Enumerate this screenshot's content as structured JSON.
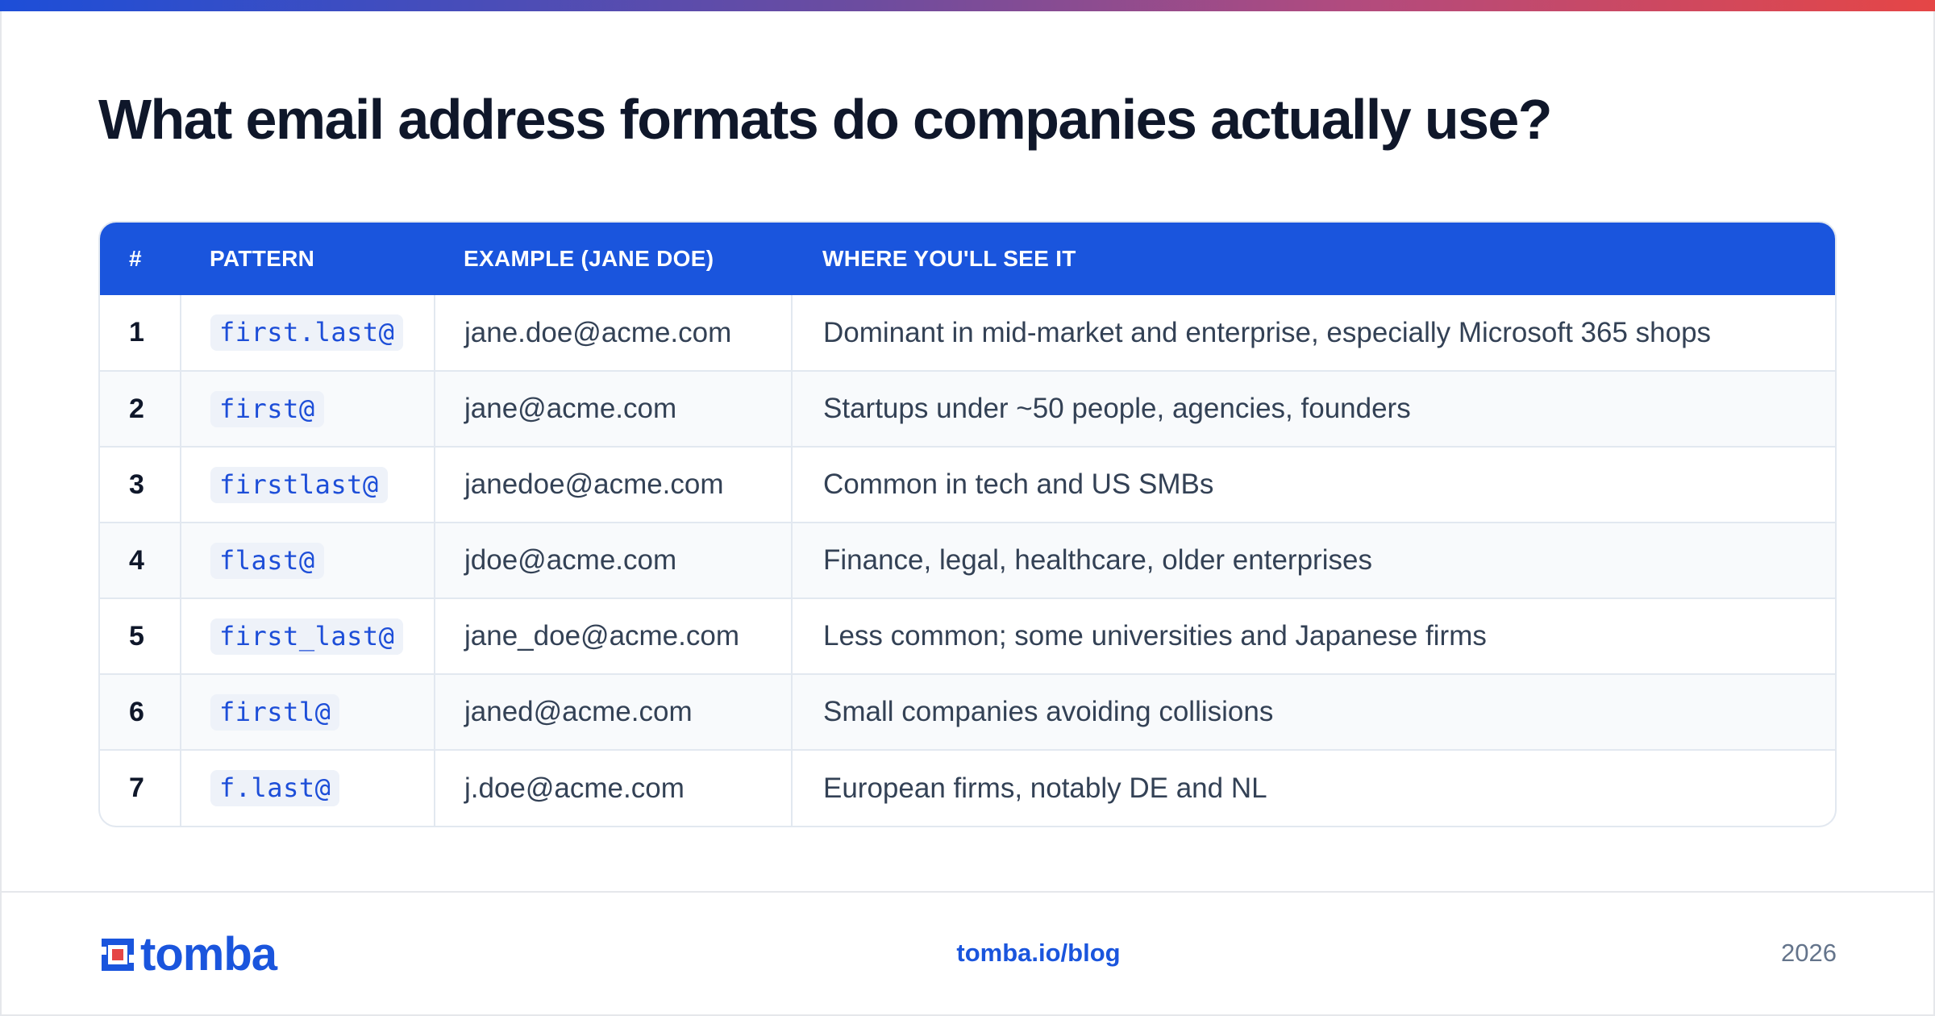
{
  "title": "What email address formats do companies actually use?",
  "colors": {
    "accent": "#1a55dd",
    "header_bg": "#1a55dd",
    "code_text": "#1d4ed8",
    "gradient_start": "#1d4ed8",
    "gradient_end": "#e54646"
  },
  "table": {
    "headers": {
      "num": "#",
      "pattern": "PATTERN",
      "example": "EXAMPLE (JANE DOE)",
      "where": "WHERE YOU'LL SEE IT"
    },
    "rows": [
      {
        "num": "1",
        "pattern": "first.last@",
        "example": "jane.doe@acme.com",
        "where": "Dominant in mid-market and enterprise, especially Microsoft 365 shops"
      },
      {
        "num": "2",
        "pattern": "first@",
        "example": "jane@acme.com",
        "where": "Startups under ~50 people, agencies, founders"
      },
      {
        "num": "3",
        "pattern": "firstlast@",
        "example": "janedoe@acme.com",
        "where": "Common in tech and US SMBs"
      },
      {
        "num": "4",
        "pattern": "flast@",
        "example": "jdoe@acme.com",
        "where": "Finance, legal, healthcare, older enterprises"
      },
      {
        "num": "5",
        "pattern": "first_last@",
        "example": "jane_doe@acme.com",
        "where": "Less common; some universities and Japanese firms"
      },
      {
        "num": "6",
        "pattern": "firstl@",
        "example": "janed@acme.com",
        "where": "Small companies avoiding collisions"
      },
      {
        "num": "7",
        "pattern": "f.last@",
        "example": "j.doe@acme.com",
        "where": "European firms, notably DE and NL"
      }
    ]
  },
  "footer": {
    "logo_text": "tomba",
    "logo_icon": "tomba-logo-icon",
    "url": "tomba.io/blog",
    "year": "2026"
  }
}
